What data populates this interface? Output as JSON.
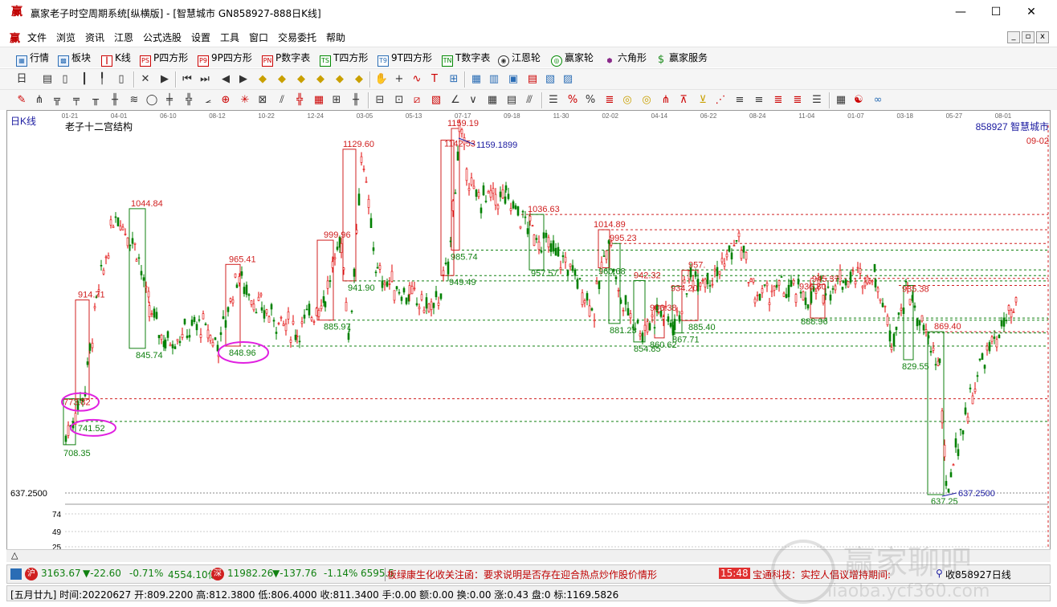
{
  "window": {
    "title": "赢家老子时空周期系统[纵横版] - [智慧城市   GN858927-888日K线]",
    "logo": "赢",
    "minimize": "—",
    "maximize": "☐",
    "close": "✕"
  },
  "menu": {
    "logo": "赢",
    "items": [
      "文件",
      "浏览",
      "资讯",
      "江恩",
      "公式选股",
      "设置",
      "工具",
      "窗口",
      "交易委托",
      "帮助"
    ],
    "mdi": [
      "_",
      "▫",
      "x"
    ]
  },
  "toolbar1": {
    "items": [
      {
        "label": "行情",
        "icon": "grid-icon"
      },
      {
        "label": "板块",
        "icon": "blocks-icon"
      },
      {
        "label": "K线",
        "icon": "kline-icon"
      },
      {
        "label": "P四方形",
        "icon": "ps-icon",
        "tag": "PS"
      },
      {
        "label": "9P四方形",
        "icon": "p9-icon",
        "tag": "P9"
      },
      {
        "label": "P数字表",
        "icon": "pn-icon",
        "tag": "PN"
      },
      {
        "label": "T四方形",
        "icon": "ts-icon",
        "tag": "TS"
      },
      {
        "label": "9T四方形",
        "icon": "t9-icon",
        "tag": "T9"
      },
      {
        "label": "T数字表",
        "icon": "tn-icon",
        "tag": "TN"
      },
      {
        "label": "江恩轮",
        "icon": "wheel-icon"
      },
      {
        "label": "赢家轮",
        "icon": "winner-wheel-icon"
      },
      {
        "label": "六角形",
        "icon": "hexagon-icon"
      },
      {
        "label": "赢家服务",
        "icon": "dollar-icon"
      }
    ]
  },
  "chart": {
    "period_label": "日K线",
    "indicator_label": "老子十二宫结构",
    "stock_label": "858927  智慧城市",
    "date_right": "09-02",
    "price_label_left": "637.2500",
    "volume_ticks": [
      "74",
      "49",
      "25"
    ],
    "date_ticks": [
      "01-21",
      "04-01",
      "06-10",
      "08-12",
      "10-22",
      "12-24",
      "03-05",
      "05-13",
      "07-17",
      "09-18",
      "11-30",
      "02-02",
      "04-14",
      "06-22",
      "08-24",
      "11-04",
      "01-07",
      "03-18",
      "05-27",
      "08-01"
    ],
    "high_label": "1159.1899",
    "low_label": "637.2500",
    "scroll_arrow": "△"
  },
  "chart_data": {
    "type": "candlestick",
    "title": "老子十二宫结构",
    "price_range": [
      637.25,
      1159.19
    ],
    "annotations_red": [
      {
        "label": "1159.19",
        "price": 1159.19
      },
      {
        "label": "1142.53",
        "price": 1142.53
      },
      {
        "label": "1129.60",
        "price": 1129.6
      },
      {
        "label": "1044.84",
        "price": 1044.84
      },
      {
        "label": "1036.63",
        "price": 1036.63
      },
      {
        "label": "1014.89",
        "price": 1014.89
      },
      {
        "label": "999.96",
        "price": 999.96
      },
      {
        "label": "995.23",
        "price": 995.23
      },
      {
        "label": "965.41",
        "price": 965.41
      },
      {
        "label": "957.",
        "price": 957.0
      },
      {
        "label": "945.37",
        "price": 945.37
      },
      {
        "label": "942.32",
        "price": 942.32
      },
      {
        "label": "936.80",
        "price": 936.8
      },
      {
        "label": "935.38",
        "price": 935.38
      },
      {
        "label": "934.20",
        "price": 934.2
      },
      {
        "label": "914.71",
        "price": 914.71
      },
      {
        "label": "906.38",
        "price": 906.38
      },
      {
        "label": "869.40",
        "price": 869.4
      },
      {
        "label": "773.82",
        "price": 773.82
      }
    ],
    "annotations_green": [
      {
        "label": "985.74",
        "price": 985.74
      },
      {
        "label": "957.57",
        "price": 957.57
      },
      {
        "label": "960.68",
        "price": 960.68
      },
      {
        "label": "949.49",
        "price": 949.49
      },
      {
        "label": "941.90",
        "price": 941.9
      },
      {
        "label": "885.97",
        "price": 885.97
      },
      {
        "label": "885.40",
        "price": 885.4
      },
      {
        "label": "888.96",
        "price": 888.96
      },
      {
        "label": "881.23",
        "price": 881.23
      },
      {
        "label": "867.71",
        "price": 867.71
      },
      {
        "label": "860.62",
        "price": 860.62
      },
      {
        "label": "854.85",
        "price": 854.85
      },
      {
        "label": "848.96",
        "price": 848.96
      },
      {
        "label": "845.74",
        "price": 845.74
      },
      {
        "label": "829.55",
        "price": 829.55
      },
      {
        "label": "741.52",
        "price": 741.52
      },
      {
        "label": "708.35",
        "price": 708.35
      },
      {
        "label": "637.25",
        "price": 637.25
      }
    ],
    "circled": [
      "773.82",
      "741.52",
      "848.96"
    ]
  },
  "status1": {
    "sh_icon": "沪",
    "sh_index": "3163.67",
    "sh_change": "▼-22.60",
    "sh_pct": "-0.71%",
    "sh_amount": "4554.10亿",
    "sz_icon": "深",
    "sz_index": "11982.26",
    "sz_change": "▼-137.76",
    "sz_pct": "-1.14%",
    "sz_amount": "6595.5",
    "news1": "板绿康生化收关注函：要求说明是否存在迎合热点炒作股价情形",
    "news_time": "15:48",
    "news2": "宝通科技：实控人倡议增持期间: ",
    "right_label": "收858927日线"
  },
  "status2": {
    "text": "[五月廿九] 时间:20220627 开:809.2200 高:812.3800 低:806.4000 收:811.3400 手:0.00 额:0.00 换:0.00 涨:0.43 盘:0 标:1169.5826"
  },
  "watermark": {
    "big": "赢家聊吧",
    "small": "liaoba.ycf360.com"
  },
  "colors": {
    "up": "#e00000",
    "down": "#008000",
    "red_line": "#d02020",
    "green_line": "#108010",
    "circle": "#e020e0",
    "blue_label": "#1a1aa0"
  }
}
